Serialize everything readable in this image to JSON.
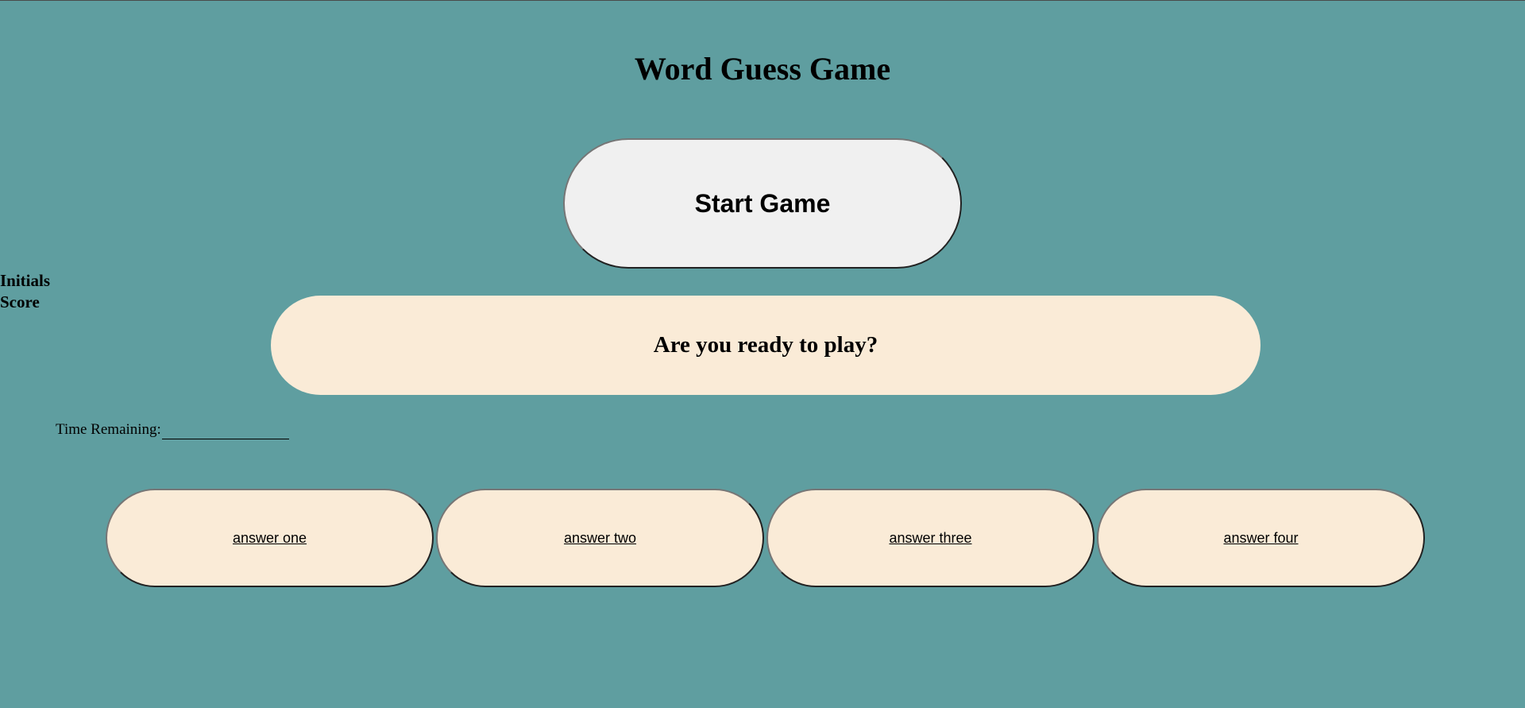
{
  "header": {
    "title": "Word Guess Game"
  },
  "controls": {
    "start_label": "Start Game"
  },
  "scoreboard": {
    "initials_label": "Initials",
    "score_label": "Score"
  },
  "question": {
    "text": "Are you ready to play?"
  },
  "timer": {
    "label": "Time Remaining:"
  },
  "answers": [
    {
      "label": "answer one"
    },
    {
      "label": "answer two"
    },
    {
      "label": "answer three"
    },
    {
      "label": "answer four"
    }
  ],
  "colors": {
    "background": "#5f9ea0",
    "panel": "#faebd7",
    "start_button": "#f0f0f0"
  }
}
